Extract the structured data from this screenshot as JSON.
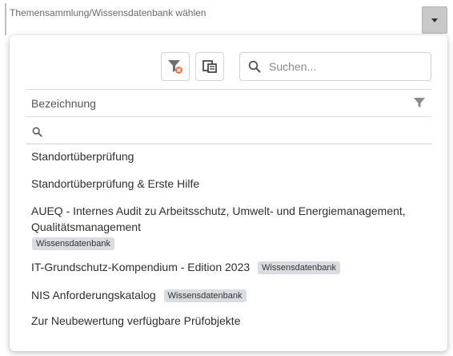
{
  "field": {
    "label": "Themensammlung/Wissensdatenbank wählen"
  },
  "toolbar": {
    "clear_filter_icon": "filter-clear-icon",
    "copy_icon": "copy-columns-icon"
  },
  "search": {
    "placeholder": "Suchen..."
  },
  "table": {
    "column_header": "Bezeichnung"
  },
  "items": [
    {
      "label": "Standortüberprüfung",
      "badge": ""
    },
    {
      "label": "Standortüberprüfung & Erste Hilfe",
      "badge": ""
    },
    {
      "label": "AUEQ - Internes Audit zu Arbeitsschutz, Umwelt- und Energiemanagement, Qualitätsmanagement",
      "badge": "Wissensdatenbank"
    },
    {
      "label": "IT-Grundschutz-Kompendium - Edition 2023",
      "badge": "Wissensdatenbank"
    },
    {
      "label": "NIS Anforderungskatalog",
      "badge": "Wissensdatenbank"
    },
    {
      "label": "Zur Neubewertung verfügbare Prüfobjekte",
      "badge": ""
    }
  ],
  "colors": {
    "accent_orange": "#e8764a",
    "badge_bg": "#d9dde1"
  }
}
